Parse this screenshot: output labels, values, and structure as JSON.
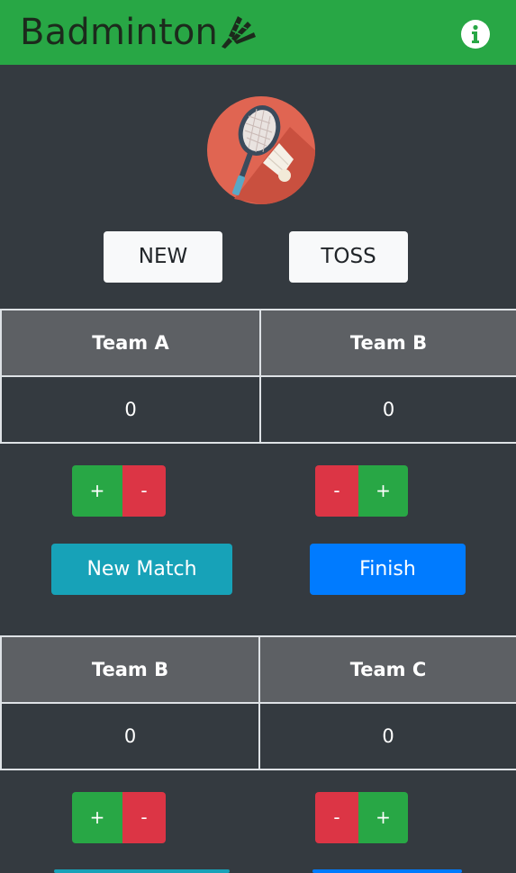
{
  "navbar": {
    "brand": "Badminton",
    "brand_icon": "shuttlecock-icon",
    "info_icon": "info-circle-icon"
  },
  "logo": {
    "icon": "racket-and-shuttlecock-logo"
  },
  "controls": {
    "new_label": "NEW",
    "toss_label": "TOSS"
  },
  "matches": [
    {
      "team_left": "Team A",
      "team_right": "Team B",
      "score_left": "0",
      "score_right": "0",
      "left_plus": "+",
      "left_minus": "-",
      "right_minus": "-",
      "right_plus": "+",
      "new_match_label": "New Match",
      "finish_label": "Finish"
    },
    {
      "team_left": "Team B",
      "team_right": "Team C",
      "score_left": "0",
      "score_right": "0",
      "left_plus": "+",
      "left_minus": "-",
      "right_minus": "-",
      "right_plus": "+"
    }
  ],
  "colors": {
    "navbar": "#28a745",
    "background": "#343a40",
    "header_cell": "#5d6064",
    "plus": "#28a745",
    "minus": "#dc3545",
    "new_match": "#17a2b8",
    "finish": "#007bff"
  }
}
